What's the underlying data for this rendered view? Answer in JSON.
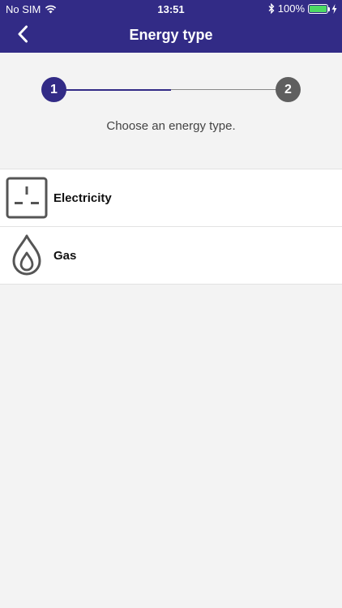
{
  "status_bar": {
    "carrier": "No SIM",
    "time": "13:51",
    "battery": "100%"
  },
  "header": {
    "title": "Energy type",
    "back_icon": "chevron-left-icon"
  },
  "stepper": {
    "steps": [
      "1",
      "2"
    ],
    "current_step": 1
  },
  "instruction": "Choose an energy type.",
  "options": [
    {
      "label": "Electricity",
      "icon": "plug-socket-icon"
    },
    {
      "label": "Gas",
      "icon": "flame-drop-icon"
    }
  ],
  "colors": {
    "brand": "#322b86",
    "inactive_step": "#5f5f5f",
    "battery": "#4cd964",
    "background": "#f3f3f3"
  }
}
